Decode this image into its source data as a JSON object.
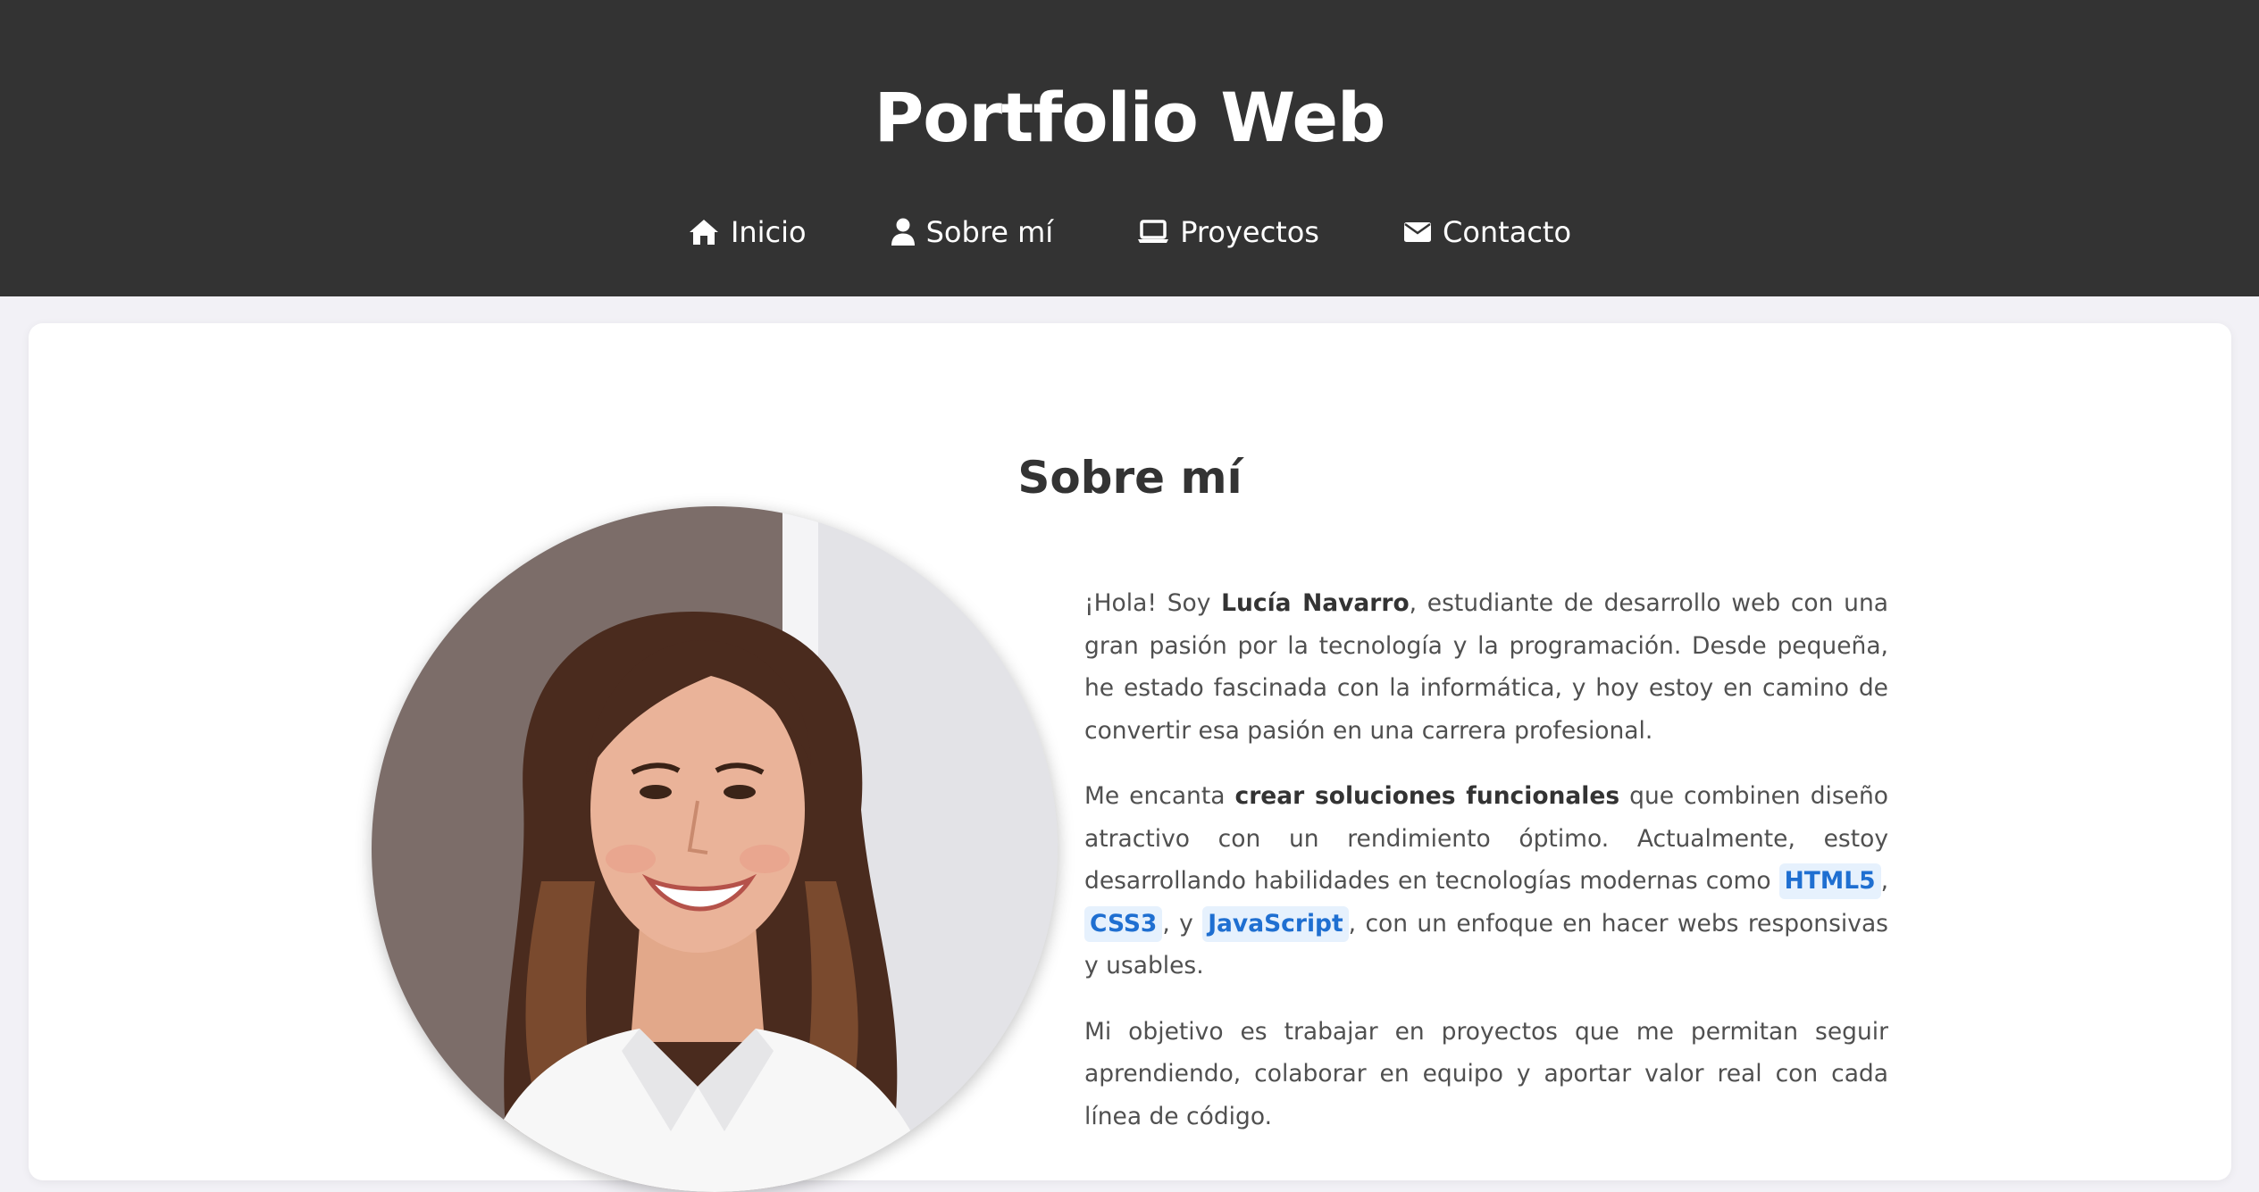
{
  "header": {
    "title": "Portfolio Web",
    "nav": [
      {
        "label": "Inicio",
        "icon": "home-icon"
      },
      {
        "label": "Sobre mí",
        "icon": "user-icon"
      },
      {
        "label": "Proyectos",
        "icon": "laptop-icon"
      },
      {
        "label": "Contacto",
        "icon": "envelope-icon"
      }
    ]
  },
  "about": {
    "title": "Sobre mí",
    "photo_icon": "profile-photo",
    "p1": {
      "a": "¡Hola! Soy ",
      "name": "Lucía Navarro",
      "b": ", estudiante de desarrollo web con una gran pasión por la tecnología y la programación. Desde pequeña, he estado fascinada con la informática, y hoy estoy en camino de convertir esa pasión en una carrera profesional."
    },
    "p2": {
      "a": "Me encanta ",
      "strong": "crear soluciones funcionales",
      "b": " que combinen diseño atractivo con un rendimiento óptimo. Actualmente, estoy desarrollando habilidades en tecnologías modernas como ",
      "tech1": "HTML5",
      "c": ", ",
      "tech2": "CSS3",
      "d": ", y ",
      "tech3": "JavaScript",
      "e": ", con un enfoque en hacer webs responsivas y usables."
    },
    "p3": "Mi objetivo es trabajar en proyectos que me permitan seguir aprendiendo, colaborar en equipo y aportar valor real con cada línea de código."
  },
  "colors": {
    "header_bg": "#333333",
    "page_bg": "#f2f1f6",
    "accent": "#1f6fd1",
    "tech_badge_bg": "#e6f1fd"
  }
}
